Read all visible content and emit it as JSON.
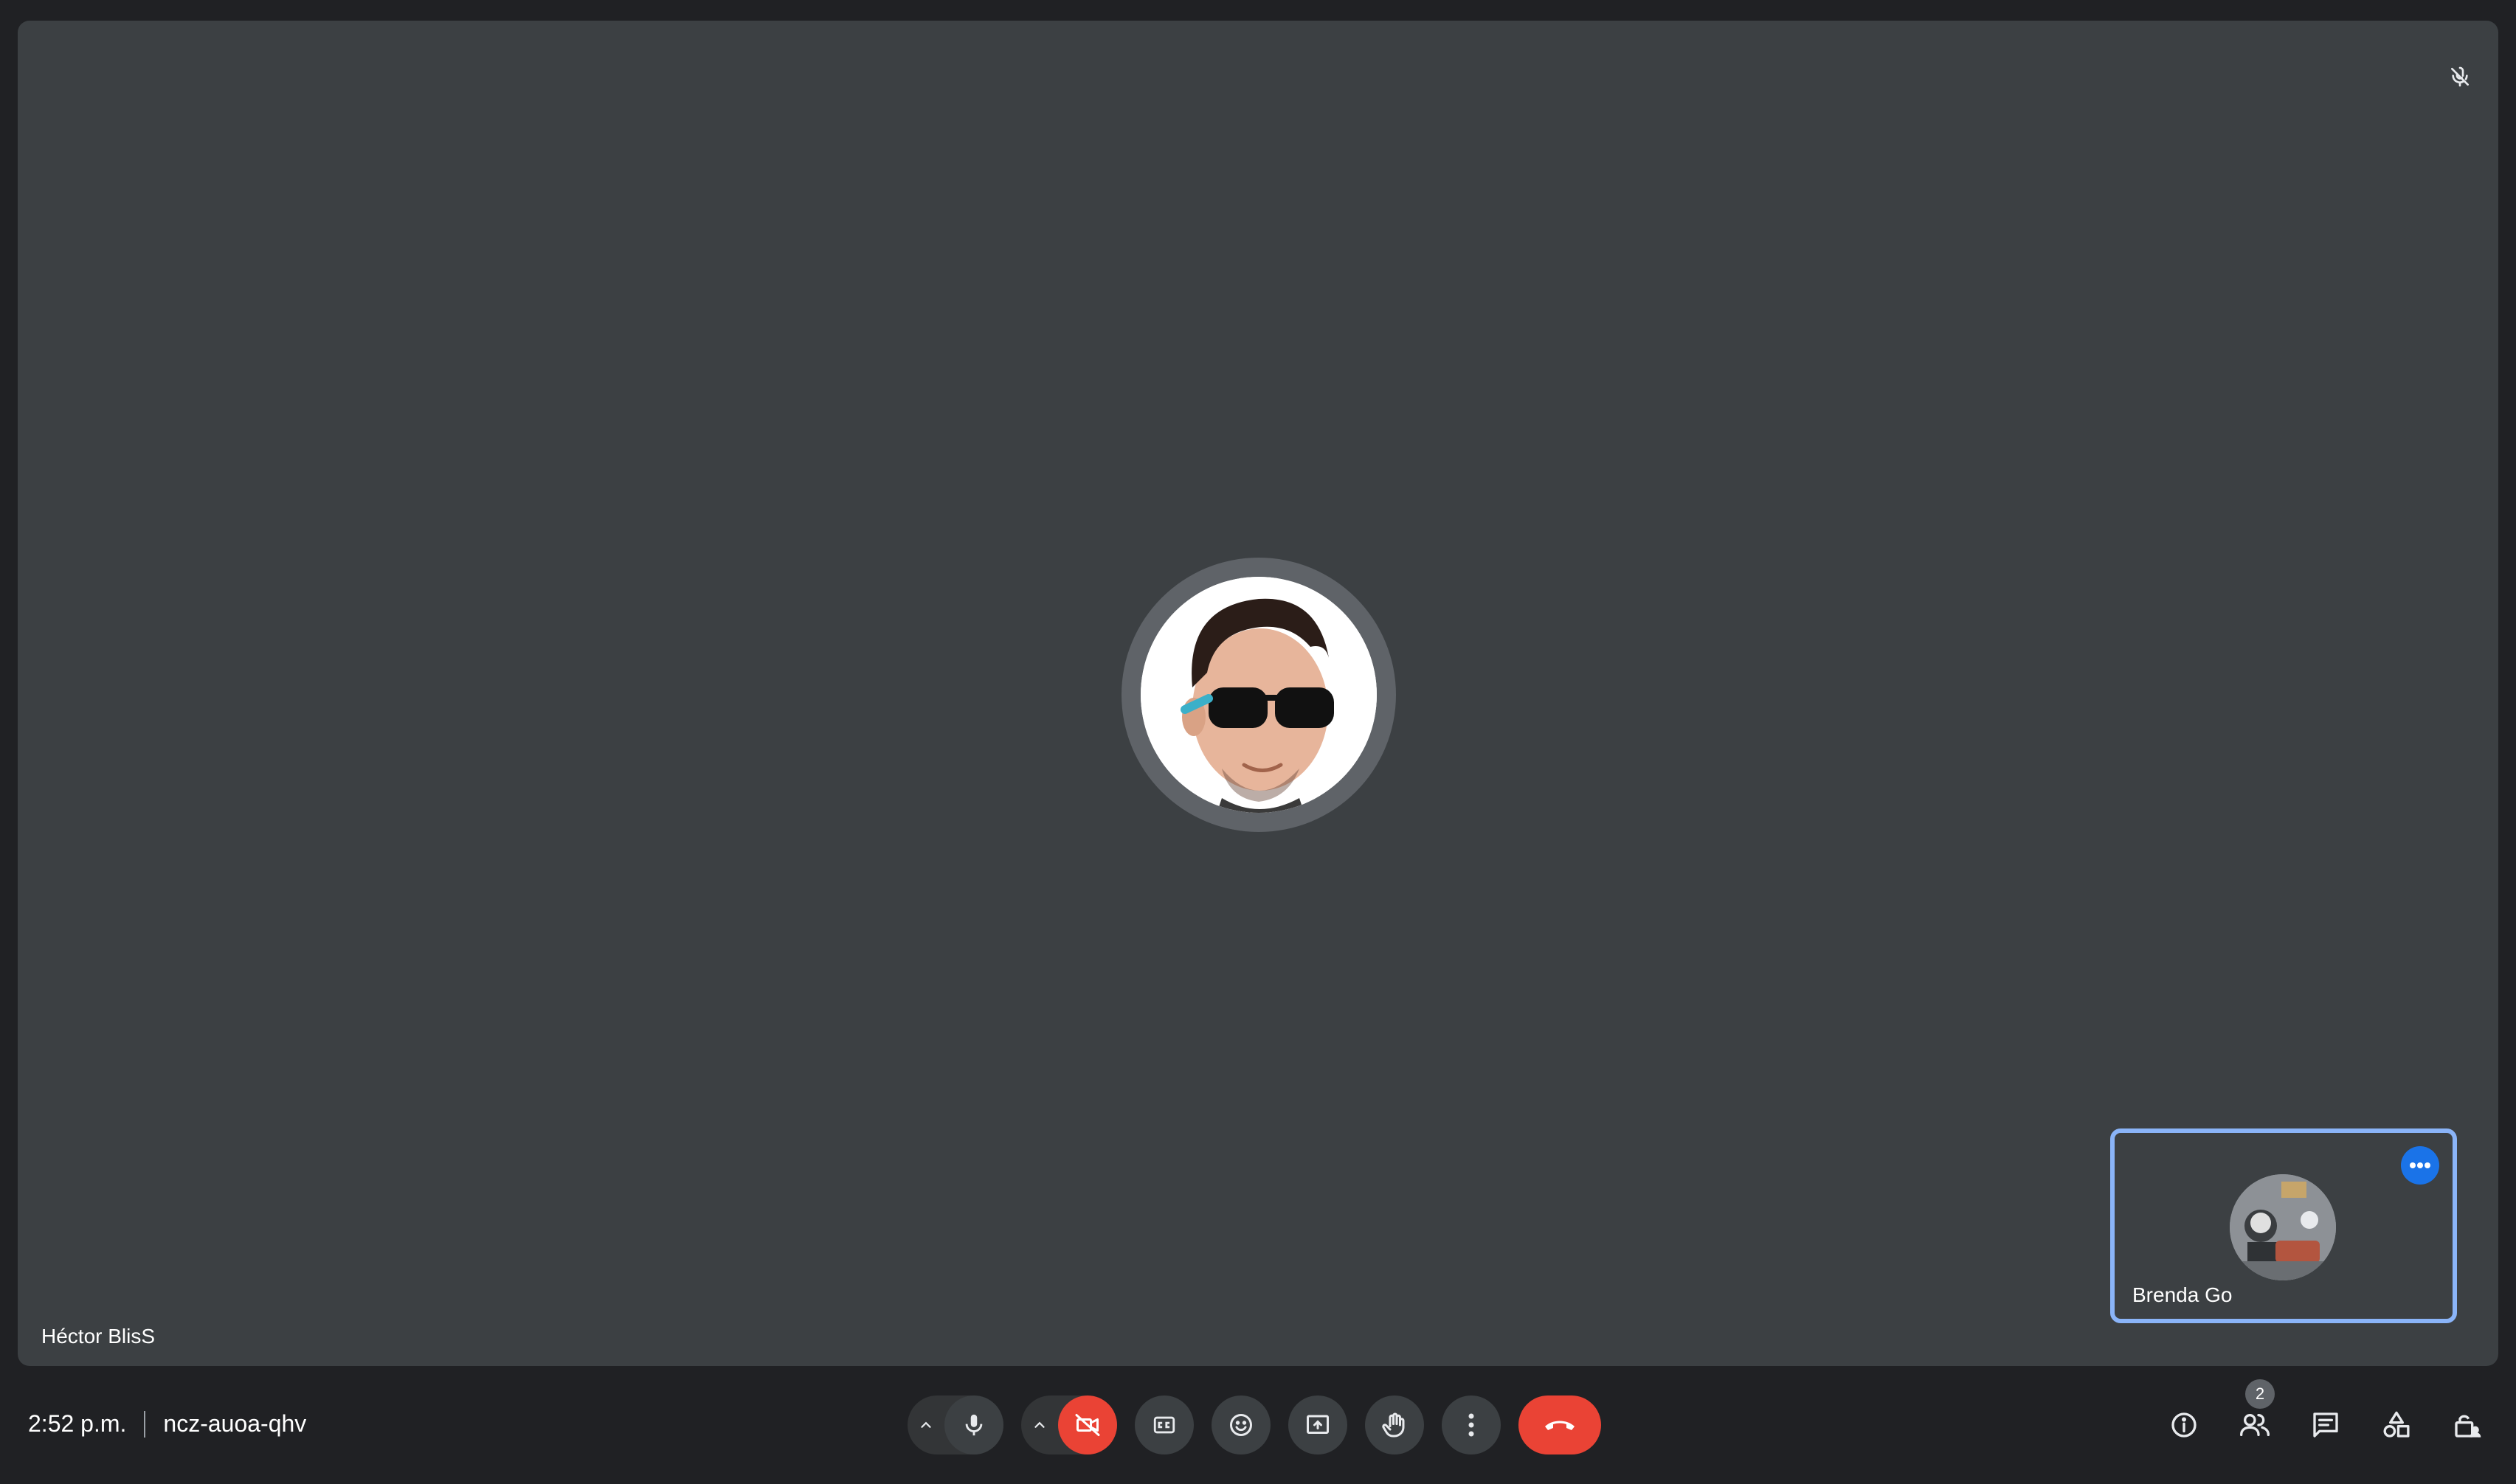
{
  "meeting": {
    "time": "2:52 p.m.",
    "code": "ncz-auoa-qhv"
  },
  "main_participant": {
    "name": "Héctor BlisS",
    "muted_icon": "mic-off-icon"
  },
  "self_tile": {
    "name": "Brenda Go",
    "more_icon": "more-horiz-icon"
  },
  "controls": {
    "mic_options": "chevron-up-icon",
    "mic": "mic-icon",
    "camera_options": "chevron-up-icon",
    "camera": "videocam-off-icon",
    "captions": "closed-captions-icon",
    "reactions": "emoji-icon",
    "present": "present-screen-icon",
    "raise_hand": "hand-icon",
    "more": "more-vert-icon",
    "leave": "call-end-icon"
  },
  "right_tools": {
    "info": "info-icon",
    "people": "people-icon",
    "people_count": "2",
    "chat": "chat-icon",
    "activities": "activities-icon",
    "host_controls": "lock-person-icon"
  },
  "colors": {
    "background": "#202124",
    "tile": "#3c4043",
    "accent_blue": "#1a73e8",
    "self_border": "#8ab4f8",
    "danger_red": "#ea4335"
  }
}
